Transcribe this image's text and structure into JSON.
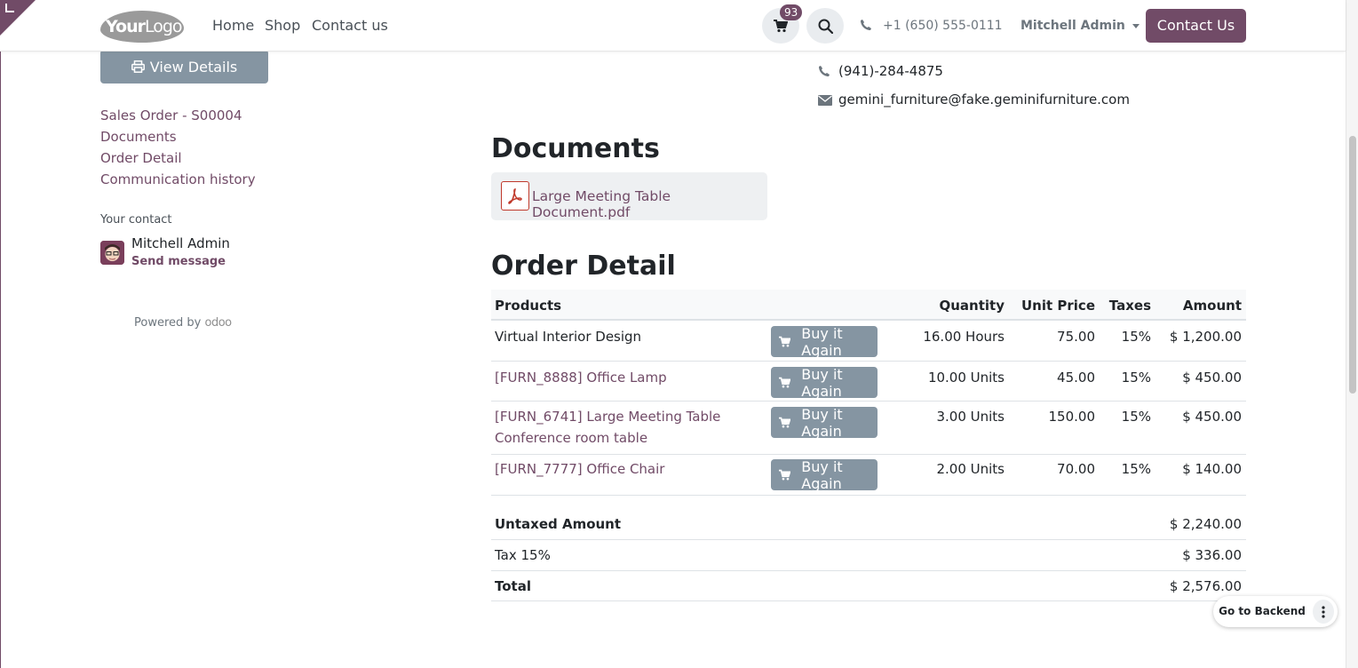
{
  "header": {
    "logo_text_bold": "Your",
    "logo_text_thin": "Logo",
    "nav": [
      "Home",
      "Shop",
      "Contact us"
    ],
    "cart_count": "93",
    "phone": "+1 (650) 555-0111",
    "user": "Mitchell Admin",
    "contact_button": "Contact Us"
  },
  "sidebar": {
    "view_details": "View Details",
    "links": [
      "Sales Order - S00004",
      "Documents",
      "Order Detail",
      "Communication history"
    ],
    "your_contact_label": "Your contact",
    "contact_name": "Mitchell Admin",
    "send_message": "Send message",
    "powered_by": "Powered by",
    "powered_brand": "odoo"
  },
  "customer": {
    "phone": "(941)-284-4875",
    "email": "gemini_furniture@fake.geminifurniture.com"
  },
  "documents": {
    "title": "Documents",
    "file_name": "Large Meeting Table Document.pdf"
  },
  "order": {
    "title": "Order Detail",
    "columns": {
      "products": "Products",
      "quantity": "Quantity",
      "unit_price": "Unit Price",
      "taxes": "Taxes",
      "amount": "Amount"
    },
    "buy_again_label": "Buy it Again",
    "lines": [
      {
        "product": "Virtual Interior Design",
        "product2": "",
        "is_link": false,
        "quantity": "16.00 Hours",
        "unit_price": "75.00",
        "taxes": "15%",
        "amount": "$ 1,200.00"
      },
      {
        "product": "[FURN_8888] Office Lamp",
        "product2": "",
        "is_link": true,
        "quantity": "10.00 Units",
        "unit_price": "45.00",
        "taxes": "15%",
        "amount": "$ 450.00"
      },
      {
        "product": "[FURN_6741] Large Meeting Table",
        "product2": "Conference room table",
        "is_link": true,
        "quantity": "3.00 Units",
        "unit_price": "150.00",
        "taxes": "15%",
        "amount": "$ 450.00"
      },
      {
        "product": "[FURN_7777] Office Chair",
        "product2": "",
        "is_link": true,
        "quantity": "2.00 Units",
        "unit_price": "70.00",
        "taxes": "15%",
        "amount": "$ 140.00"
      }
    ],
    "totals": {
      "untaxed_label": "Untaxed Amount",
      "untaxed_value": "$ 2,240.00",
      "tax_label": "Tax 15%",
      "tax_value": "$ 336.00",
      "total_label": "Total",
      "total_value": "$ 2,576.00"
    }
  },
  "backend": {
    "label": "Go to Backend"
  },
  "colors": {
    "brand": "#714B67",
    "secondary_button": "#8595a2"
  }
}
